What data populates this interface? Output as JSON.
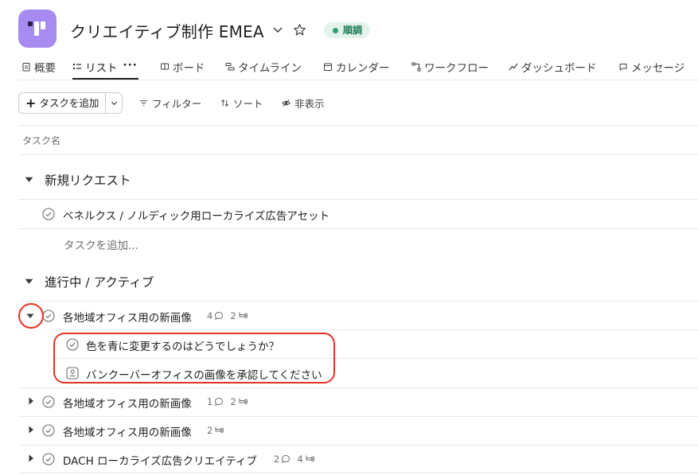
{
  "project": {
    "title": "クリエイティブ制作 EMEA",
    "status": "順調",
    "icon": "project-app-icon",
    "accent_color": "#a88bf0",
    "status_color": "#2f9e6e"
  },
  "tabs": [
    {
      "label": "概要",
      "icon": "overview-icon"
    },
    {
      "label": "リスト",
      "icon": "list-icon",
      "active": true,
      "more": "···"
    },
    {
      "label": "ボード",
      "icon": "board-icon"
    },
    {
      "label": "タイムライン",
      "icon": "timeline-icon"
    },
    {
      "label": "カレンダー",
      "icon": "calendar-icon"
    },
    {
      "label": "ワークフロー",
      "icon": "workflow-icon"
    },
    {
      "label": "ダッシュボード",
      "icon": "dashboard-icon"
    },
    {
      "label": "メッセージ",
      "icon": "message-icon"
    }
  ],
  "toolbar": {
    "add_task": "タスクを追加",
    "filter": "フィルター",
    "sort": "ソート",
    "hide": "非表示"
  },
  "columns": {
    "task_name": "タスク名"
  },
  "sections": [
    {
      "title": "新規リクエスト",
      "tasks": [
        {
          "name": "ベネルクス / ノルディック用ローカライズ広告アセット"
        }
      ],
      "add_task": "タスクを追加..."
    },
    {
      "title": "進行中 / アクティブ",
      "tasks": [
        {
          "name": "各地域オフィス用の新画像",
          "comments": "4",
          "subtasks": "2",
          "expanded": true,
          "children": [
            {
              "name": "色を青に変更するのはどうでしょうか？",
              "type": "task"
            },
            {
              "name": "バンクーバーオフィスの画像を承認してください",
              "type": "approval"
            }
          ]
        },
        {
          "name": "各地域オフィス用の新画像",
          "comments": "1",
          "subtasks": "2"
        },
        {
          "name": "各地域オフィス用の新画像",
          "subtasks": "2"
        },
        {
          "name": "DACH ローカライズ広告クリエイティブ",
          "comments": "2",
          "subtasks": "4"
        }
      ]
    }
  ],
  "annotations": {
    "highlight_color": "#e53224"
  }
}
